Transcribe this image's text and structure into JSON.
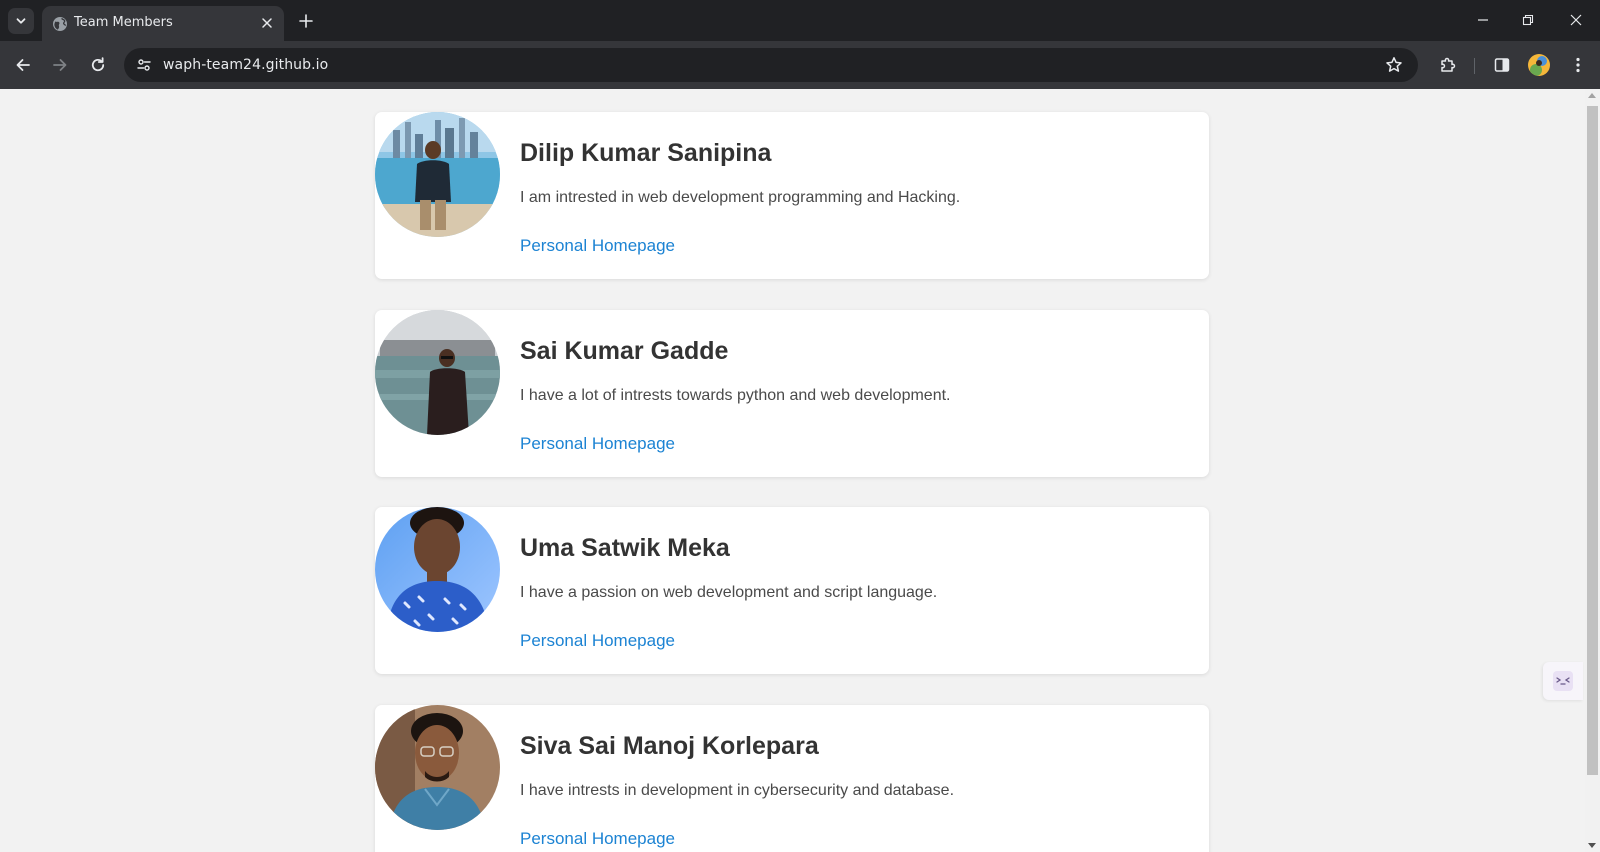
{
  "browser": {
    "tab_title": "Team Members",
    "url": "waph-team24.github.io"
  },
  "members": [
    {
      "name": "Dilip Kumar Sanipina",
      "bio": "I am intrested in web development programming and Hacking.",
      "link_label": "Personal Homepage"
    },
    {
      "name": "Sai Kumar Gadde",
      "bio": "I have a lot of intrests towards python and web development.",
      "link_label": "Personal Homepage"
    },
    {
      "name": "Uma Satwik Meka",
      "bio": "I have a passion on web development and script language.",
      "link_label": "Personal Homepage"
    },
    {
      "name": "Siva Sai Manoj Korlepara",
      "bio": "I have intrests in development in cybersecurity and database.",
      "link_label": "Personal Homepage"
    }
  ],
  "colors": {
    "page_background": "#f2f2f2",
    "card_background": "#ffffff",
    "name_text": "#333333",
    "link": "#1c83d3",
    "chrome_dark": "#202124",
    "chrome_toolbar": "#35363a"
  },
  "icons": {
    "tab_search": "chevron-down-icon",
    "tab_favicon": "globe-icon",
    "tab_close": "close-icon",
    "new_tab": "plus-icon",
    "minimize": "minimize-icon",
    "restore": "restore-icon",
    "close_window": "close-window-icon",
    "back": "back-arrow-icon",
    "forward": "forward-arrow-icon",
    "reload": "reload-icon",
    "site_info": "tune-icon",
    "bookmark": "star-icon",
    "extensions": "puzzle-icon",
    "side_panel": "side-panel-icon",
    "menu": "kebab-menu-icon",
    "profile": "avatar"
  }
}
